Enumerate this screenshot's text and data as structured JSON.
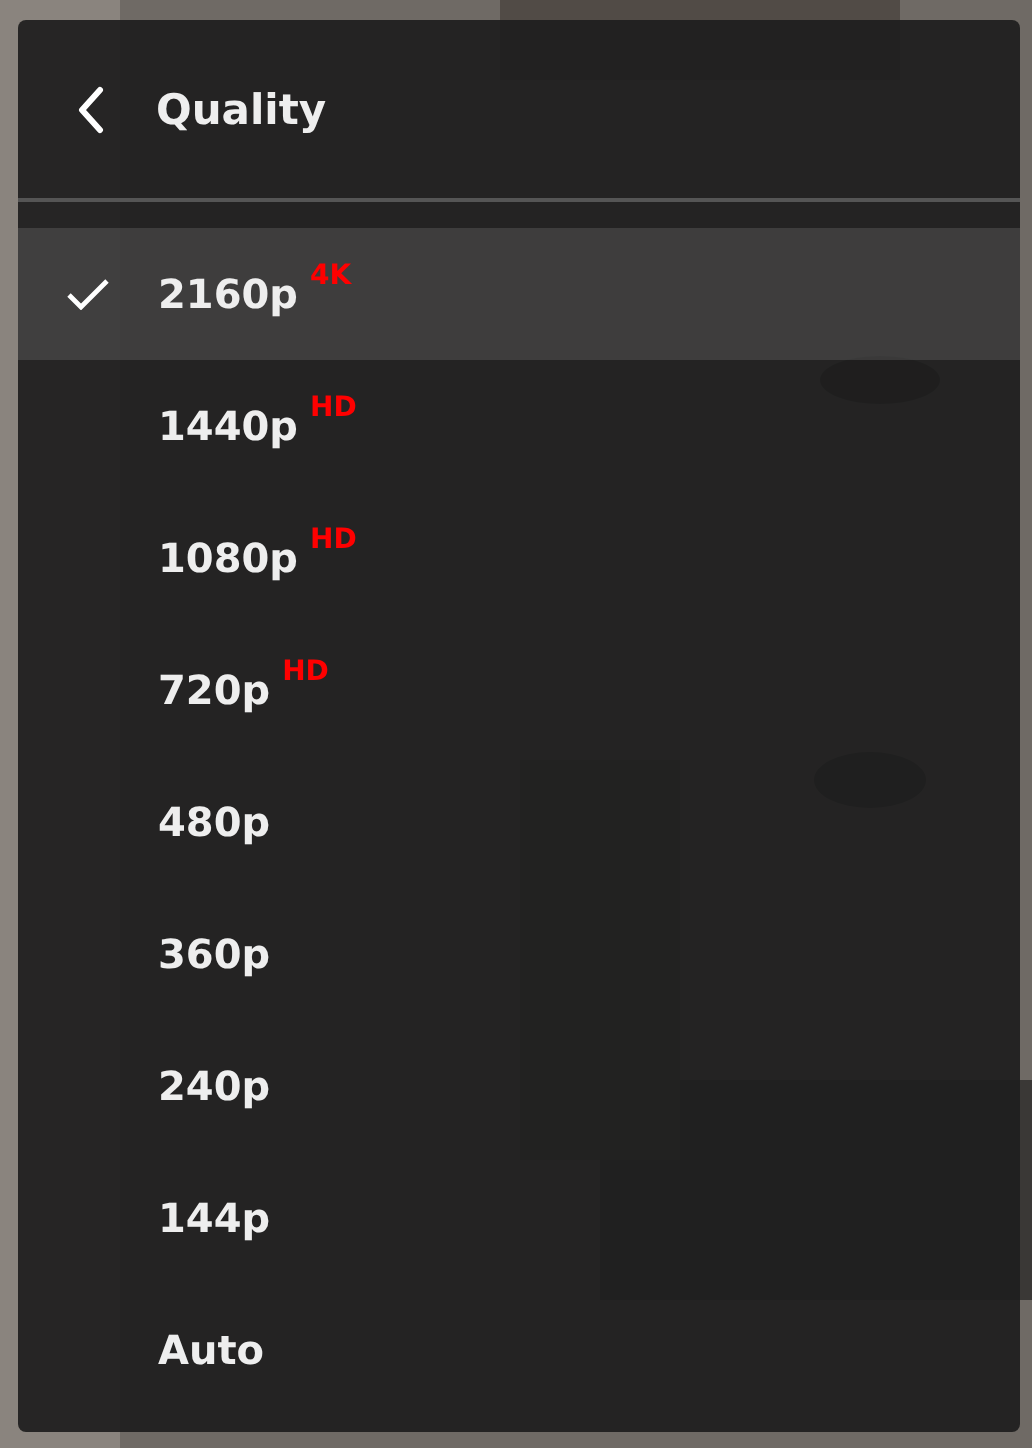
{
  "menu": {
    "title": "Quality",
    "options": [
      {
        "label": "2160p",
        "badge": "4K",
        "selected": true
      },
      {
        "label": "1440p",
        "badge": "HD",
        "selected": false
      },
      {
        "label": "1080p",
        "badge": "HD",
        "selected": false
      },
      {
        "label": "720p",
        "badge": "HD",
        "selected": false
      },
      {
        "label": "480p",
        "selected": false
      },
      {
        "label": "360p",
        "selected": false
      },
      {
        "label": "240p",
        "selected": false
      },
      {
        "label": "144p",
        "selected": false
      },
      {
        "label": "Auto",
        "selected": false
      }
    ]
  }
}
